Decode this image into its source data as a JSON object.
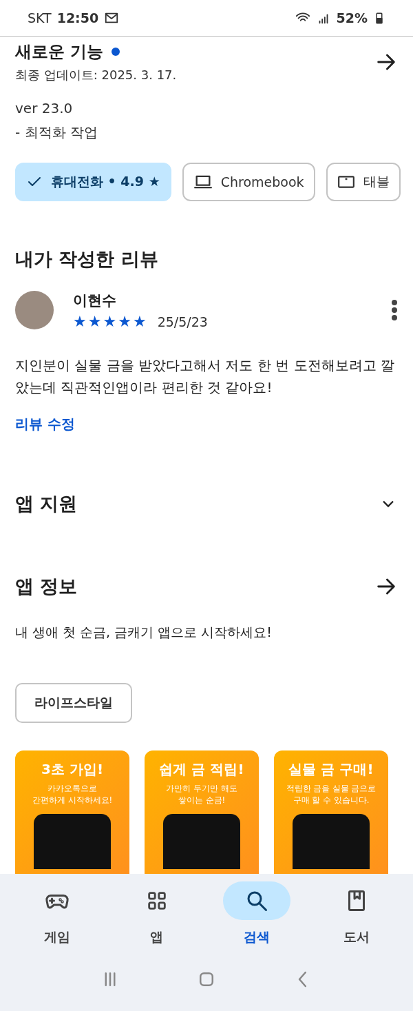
{
  "status_bar": {
    "carrier": "SKT",
    "time": "12:50",
    "battery": "52%"
  },
  "whats_new": {
    "title": "새로운 기능",
    "updated": "최종 업데이트: 2025. 3. 17.",
    "notes": [
      "ver 23.0",
      "- 최적화 작업"
    ]
  },
  "device_chips": [
    {
      "kind": "phone",
      "label": "휴대전화 • 4.9 ★",
      "selected": true
    },
    {
      "kind": "laptop",
      "label": "Chromebook",
      "selected": false
    },
    {
      "kind": "tablet",
      "label": "태블",
      "selected": false
    }
  ],
  "my_review": {
    "heading": "내가 작성한 리뷰",
    "author": "이현수",
    "stars": 5,
    "date": "25/5/23",
    "text": "지인분이 실물 금을 받았다고해서 저도 한 번 도전해보려고 깔았는데 직관적인앱이라 편리한 것 같아요!",
    "edit_link": "리뷰 수정"
  },
  "app_support": {
    "title": "앱 지원",
    "expanded": false
  },
  "app_info": {
    "title": "앱 정보",
    "description": "내 생애 첫 순금, 금캐기 앱으로 시작하세요!",
    "category": "라이프스타일"
  },
  "screenshots": [
    {
      "headline": "3초 가입!",
      "caption": "카카오톡으로\n간편하게 시작하세요!"
    },
    {
      "headline": "쉽게 금 적립!",
      "caption": "가만히 두기만 해도\n쌓이는 순금!"
    },
    {
      "headline": "실물 금 구매!",
      "caption": "적립한 금을 실물 금으로\n구매 할 수 있습니다."
    }
  ],
  "bottom_nav": [
    {
      "kind": "games",
      "label": "게임",
      "selected": false
    },
    {
      "kind": "apps",
      "label": "앱",
      "selected": false
    },
    {
      "kind": "search",
      "label": "검색",
      "selected": true
    },
    {
      "kind": "books",
      "label": "도서",
      "selected": false
    }
  ]
}
